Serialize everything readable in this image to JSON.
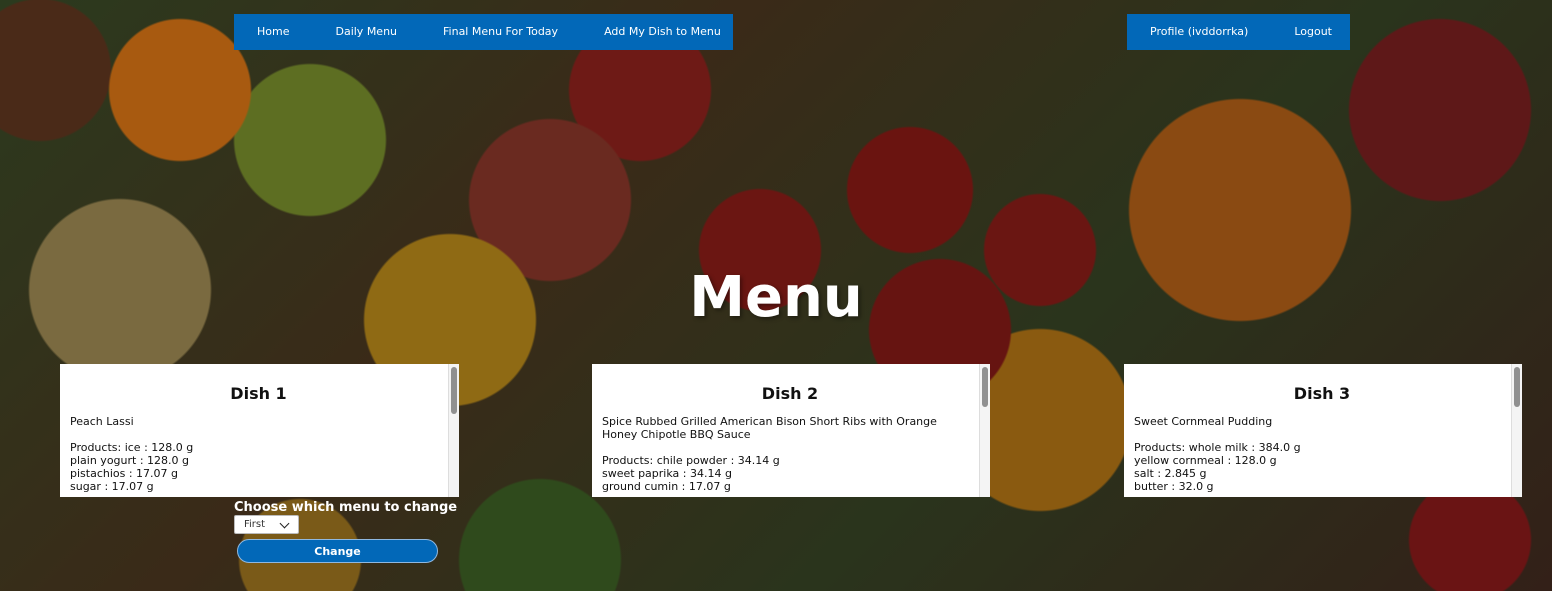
{
  "nav": {
    "left": [
      "Home",
      "Daily Menu",
      "Final Menu For Today",
      "Add My Dish to Menu"
    ],
    "right": [
      "Profile (ivddorrka)",
      "Logout"
    ]
  },
  "page_title": "Menu",
  "dishes": [
    {
      "title": "Dish 1",
      "name": "Peach Lassi",
      "products": [
        "Products: ice : 128.0 g",
        "plain yogurt : 128.0 g",
        "pistachios : 17.07 g",
        "sugar : 17.07 g"
      ]
    },
    {
      "title": "Dish 2",
      "name": "Spice Rubbed Grilled American Bison Short Ribs with Orange Honey Chipotle BBQ Sauce",
      "products": [
        "Products: chile powder : 34.14 g",
        "sweet paprika : 34.14 g",
        "ground cumin : 17.07 g"
      ]
    },
    {
      "title": "Dish 3",
      "name": "Sweet Cornmeal Pudding",
      "products": [
        "Products: whole milk : 384.0 g",
        "yellow cornmeal : 128.0 g",
        "salt : 2.845 g",
        "butter : 32.0 g"
      ]
    }
  ],
  "change_form": {
    "label": "Choose which menu to change",
    "selected": "First",
    "button": "Change"
  }
}
